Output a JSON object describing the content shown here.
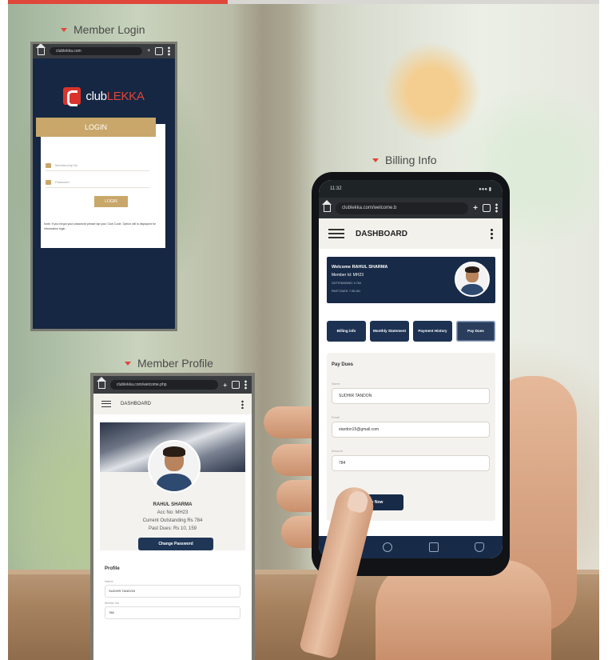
{
  "captions": {
    "login": "Member Login",
    "billing": "Billing Info",
    "profile": "Member Profile"
  },
  "colors": {
    "accent": "#e0463a",
    "navy": "#172a47",
    "gold": "#c9a76a"
  },
  "login_screen": {
    "url": "clublekka.com",
    "brand_prefix": "club",
    "brand_suffix": "LEKKA",
    "header": "LOGIN",
    "membership_placeholder": "Membership No",
    "password_placeholder": "Password",
    "login_button": "LOGIN",
    "note": "Note: If you forgot your password please tap your Club Code. Option will is displayed for information login."
  },
  "billing_screen": {
    "time": "11:32",
    "url": "clublekka.com/welcome.b",
    "title": "DASHBOARD",
    "welcome_line": "Welcome RAHUL SHARMA",
    "member_line": "Member Id: MH23",
    "outstanding_line": "OUTSTANDING: 0.764",
    "past_dues_line": "PAST DUES: 7.06.161",
    "tabs": [
      "Billing info",
      "Monthly Statement",
      "Payment History",
      "Pay Dues"
    ],
    "section_title": "Pay Dues",
    "name_label": "Name",
    "name_value": "SUDHIR TANDON",
    "email_label": "Email",
    "email_value": "stardon15@gmail.com",
    "amount_label": "Amount",
    "amount_value": "784",
    "pay_button": "Pay Now"
  },
  "profile_screen": {
    "url": "clublekka.com/welcome.php",
    "title": "DASHBOARD",
    "name": "RAHUL SHARMA",
    "acc_no": "Acc No: MH23",
    "current_outstanding": "Current Outstanding Rs 784",
    "past_dues": "Past Dues: Rs 10, 159",
    "change_password": "Change Password",
    "section_title": "Profile",
    "name_label": "Name",
    "name_value": "SUDHIR TANDON",
    "mobile_label": "Mobile No",
    "mobile_value": "786"
  }
}
